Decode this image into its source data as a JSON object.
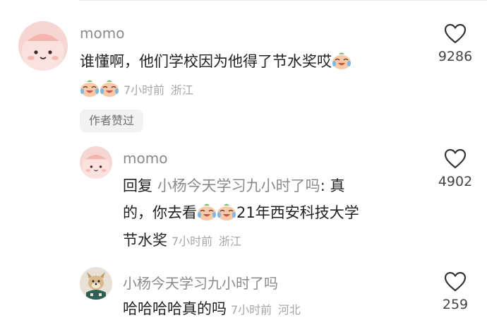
{
  "comments": [
    {
      "username": "momo",
      "text_before_emoji": "谁懂啊，他们学校因为他得了节水奖哎",
      "emoji_names": [
        "laughing-crying-emoji"
      ],
      "time": "7小时前",
      "location": "浙江",
      "likes": "9286",
      "author_badge": "作者赞过"
    },
    {
      "username": "momo",
      "reply_prefix": "回复",
      "reply_target": "小杨今天学习九小时了吗",
      "line1_suffix": ": 真",
      "line2_before": "的，你去看",
      "line2_after": "21年西安科技大学",
      "line3": "节水奖",
      "time": "7小时前",
      "location": "浙江",
      "likes": "4902"
    },
    {
      "username": "小杨今天学习九小时了吗",
      "text": "哈哈哈哈真的吗",
      "time": "7小时前",
      "location": "河北",
      "likes": "259"
    }
  ],
  "icons": {
    "like": "heart-outline-icon",
    "emoji": "laughing-crying-emoji"
  },
  "colors": {
    "username": "#8a8a8a",
    "text": "#222222",
    "meta": "#a6a6a6",
    "badge_bg": "#f2f2f2",
    "avatar_pink": "#f6d6d2"
  }
}
